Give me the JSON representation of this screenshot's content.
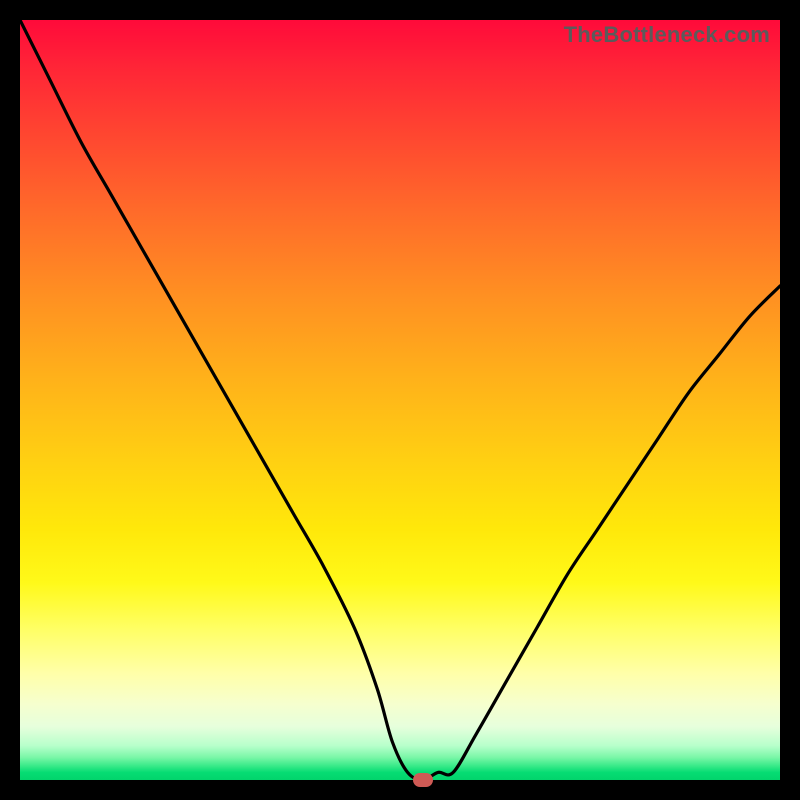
{
  "watermark": "TheBottleneck.com",
  "chart_data": {
    "type": "line",
    "title": "",
    "xlabel": "",
    "ylabel": "",
    "xlim": [
      0,
      100
    ],
    "ylim": [
      0,
      100
    ],
    "grid": false,
    "legend": false,
    "notes": "V-shaped bottleneck curve on a red→green vertical gradient. 0 on the y-axis (bottom) = no bottleneck (green); 100 (top) = severe bottleneck (red). A small marker sits at the curve minimum.",
    "series": [
      {
        "name": "bottleneck-curve",
        "x": [
          0,
          4,
          8,
          12,
          16,
          20,
          24,
          28,
          32,
          36,
          40,
          44,
          47,
          49,
          51,
          53,
          55,
          57,
          60,
          64,
          68,
          72,
          76,
          80,
          84,
          88,
          92,
          96,
          100
        ],
        "y": [
          100,
          92,
          84,
          77,
          70,
          63,
          56,
          49,
          42,
          35,
          28,
          20,
          12,
          5,
          1,
          0,
          1,
          1,
          6,
          13,
          20,
          27,
          33,
          39,
          45,
          51,
          56,
          61,
          65
        ]
      }
    ],
    "marker": {
      "x": 53,
      "y": 0
    }
  }
}
